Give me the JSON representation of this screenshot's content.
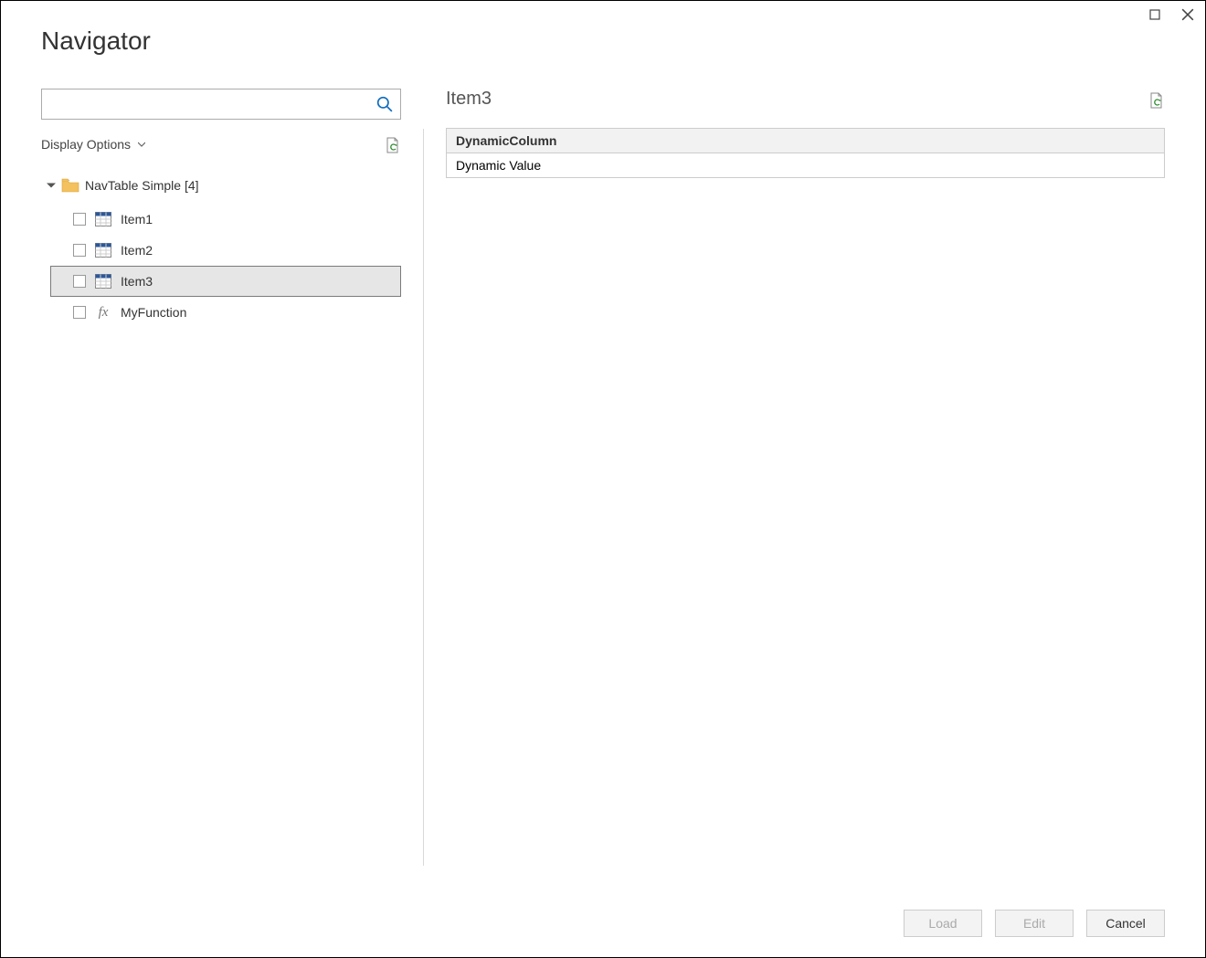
{
  "window": {
    "title": "Navigator"
  },
  "left": {
    "search_placeholder": "",
    "display_options_label": "Display Options",
    "root": {
      "label": "NavTable Simple [4]"
    },
    "items": [
      {
        "label": "Item1",
        "type": "table",
        "selected": false
      },
      {
        "label": "Item2",
        "type": "table",
        "selected": false
      },
      {
        "label": "Item3",
        "type": "table",
        "selected": true
      },
      {
        "label": "MyFunction",
        "type": "function",
        "selected": false
      }
    ]
  },
  "preview": {
    "title": "Item3",
    "column_header": "DynamicColumn",
    "cell_value": "Dynamic Value"
  },
  "footer": {
    "load_label": "Load",
    "edit_label": "Edit",
    "cancel_label": "Cancel"
  }
}
